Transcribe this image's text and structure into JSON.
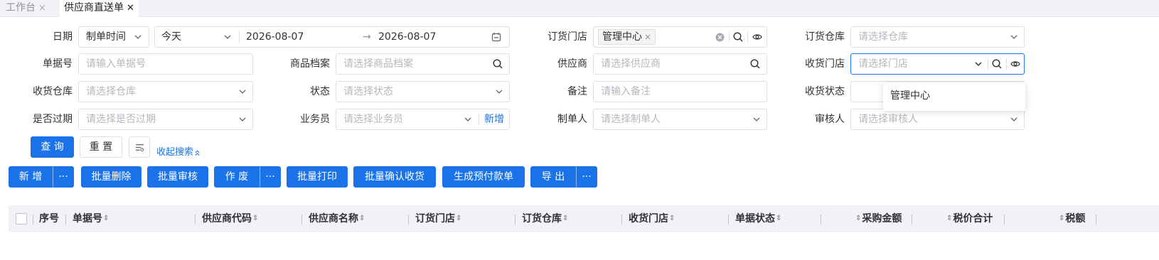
{
  "tabs": [
    {
      "label": "工作台",
      "close": "×"
    },
    {
      "label": "供应商直送单",
      "close": "✕"
    }
  ],
  "form": {
    "date_label": "日期",
    "date_type": "制单时间",
    "date_range_preset": "今天",
    "date_from": "2026-08-07",
    "date_arrow": "→",
    "date_to": "2026-08-07",
    "order_store_label": "订货门店",
    "order_store_tag": "管理中心",
    "order_store_tag_close": "×",
    "order_warehouse_label": "订货仓库",
    "order_warehouse_placeholder": "请选择仓库",
    "doc_no_label": "单据号",
    "doc_no_placeholder": "请输入单据号",
    "product_label": "商品档案",
    "product_placeholder": "请选择商品档案",
    "supplier_label": "供应商",
    "supplier_placeholder": "请选择供应商",
    "receive_store_label": "收货门店",
    "receive_store_placeholder": "请选择门店",
    "receive_warehouse_label": "收货仓库",
    "receive_warehouse_placeholder": "请选择仓库",
    "status_label": "状态",
    "status_placeholder": "请选择状态",
    "remark_label": "备注",
    "remark_placeholder": "请输入备注",
    "receive_status_label": "收货状态",
    "expired_label": "是否过期",
    "expired_placeholder": "请选择是否过期",
    "salesman_label": "业务员",
    "salesman_placeholder": "请选择业务员",
    "salesman_add": "新增",
    "creator_label": "制单人",
    "creator_placeholder": "请选择制单人",
    "auditor_label": "审核人",
    "auditor_placeholder": "请选择审核人"
  },
  "dropdown": {
    "option": "管理中心"
  },
  "search_actions": {
    "query": "查 询",
    "reset": "重 置",
    "collapse": "收起搜索"
  },
  "toolbar": {
    "add": "新 增",
    "more": "···",
    "batch_delete": "批量删除",
    "batch_audit": "批量审核",
    "void": "作 废",
    "batch_print": "批量打印",
    "batch_confirm": "批量确认收货",
    "gen_prepay": "生成预付款单",
    "export": "导 出"
  },
  "table": {
    "columns": [
      "序号",
      "单据号",
      "供应商代码",
      "供应商名称",
      "订货门店",
      "订货仓库",
      "收货门店",
      "单据状态",
      "采购金额",
      "税价合计",
      "税额"
    ]
  },
  "colors": {
    "primary": "#1a73e8",
    "header_bg": "#f0f2f5"
  }
}
